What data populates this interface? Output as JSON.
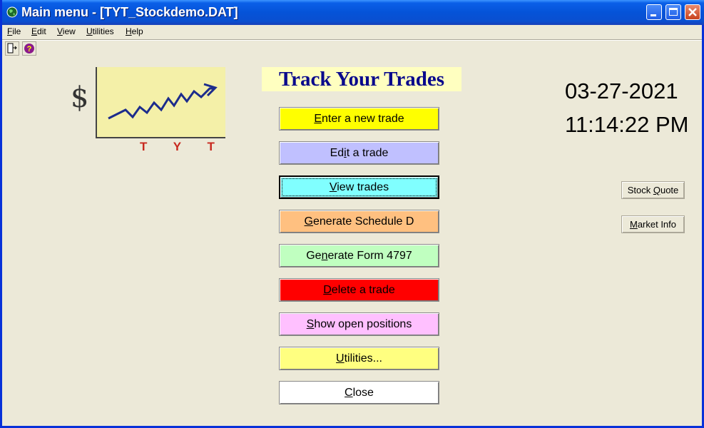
{
  "window": {
    "title": "Main menu - [TYT_Stockdemo.DAT]"
  },
  "menu": [
    {
      "label": "File",
      "accel": "F"
    },
    {
      "label": "Edit",
      "accel": "E"
    },
    {
      "label": "View",
      "accel": "V"
    },
    {
      "label": "Utilities",
      "accel": "U"
    },
    {
      "label": "Help",
      "accel": "H"
    }
  ],
  "toolbar": [
    {
      "icon": "exit-door-icon"
    },
    {
      "icon": "help-question-icon"
    }
  ],
  "logo": {
    "symbol": "$",
    "letters": "T Y T"
  },
  "app_title": "Track Your Trades",
  "date": "03-27-2021",
  "time": "11:14:22 PM",
  "buttons": [
    {
      "pre": "",
      "accel": "E",
      "post": "nter a new trade",
      "color": "#ffff00"
    },
    {
      "pre": "Ed",
      "accel": "i",
      "post": "t a trade",
      "color": "#c0c0ff"
    },
    {
      "pre": "",
      "accel": "V",
      "post": "iew trades",
      "color": "#80ffff"
    },
    {
      "pre": "",
      "accel": "G",
      "post": "enerate Schedule D",
      "color": "#ffc080"
    },
    {
      "pre": "Ge",
      "accel": "n",
      "post": "erate Form 4797",
      "color": "#c0ffc0"
    },
    {
      "pre": "",
      "accel": "D",
      "post": "elete a trade",
      "color": "#ff0000"
    },
    {
      "pre": "",
      "accel": "S",
      "post": "how open positions",
      "color": "#ffc0ff"
    },
    {
      "pre": "",
      "accel": "U",
      "post": "tilities...",
      "color": "#ffff80"
    },
    {
      "pre": "",
      "accel": "C",
      "post": "lose",
      "color": "#ffffff"
    }
  ],
  "side_buttons": [
    {
      "pre": "Stock ",
      "accel": "Q",
      "post": "uote"
    },
    {
      "pre": "",
      "accel": "M",
      "post": "arket Info"
    }
  ]
}
